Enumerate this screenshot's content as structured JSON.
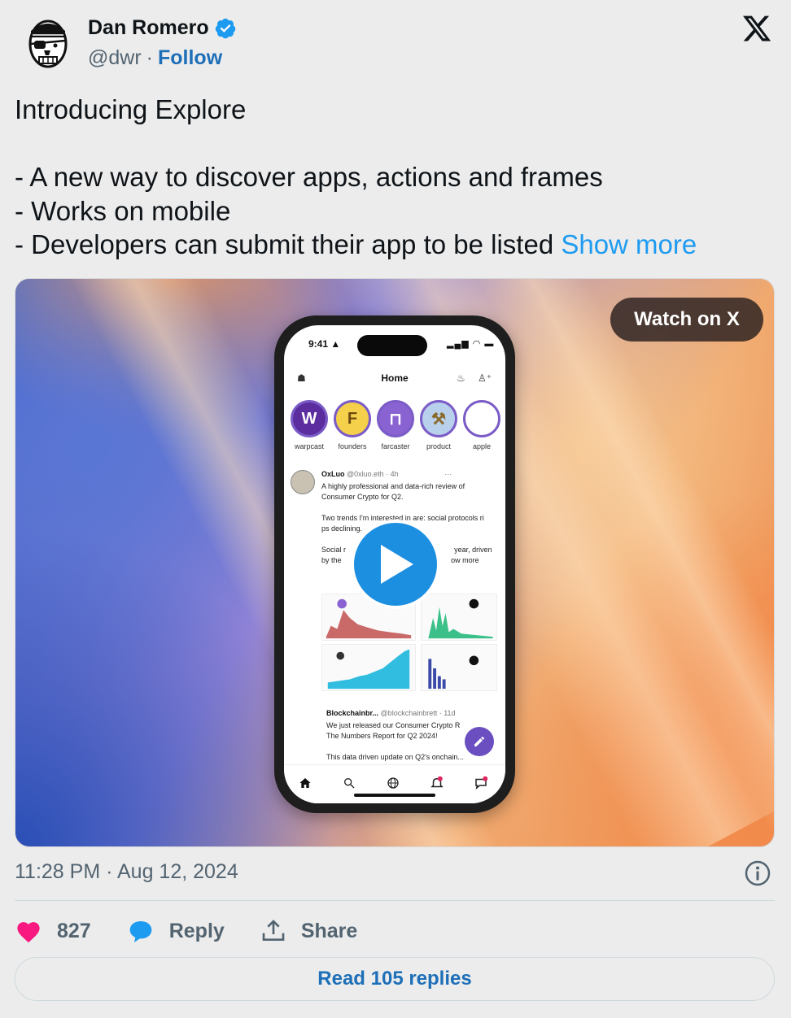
{
  "author": {
    "name": "Dan Romero",
    "handle": "@dwr",
    "separator": "·",
    "follow_label": "Follow",
    "verified": true
  },
  "tweet": {
    "text": "Introducing Explore\n\n- A new way to discover apps, actions and frames\n- Works on mobile\n- Developers can submit their app to be listed ",
    "show_more_label": "Show more"
  },
  "media": {
    "watch_label": "Watch on X",
    "phone": {
      "status_time": "9:41",
      "app_title": "Home",
      "channels": [
        {
          "glyph": "W",
          "label": "warpcast",
          "color": "#5b2d9e",
          "bg": "#5b2d9e",
          "fg": "#ffffff"
        },
        {
          "glyph": "F",
          "label": "founders",
          "color": "#d8a820",
          "bg": "#f5d04a",
          "fg": "#6b4a10"
        },
        {
          "glyph": "⊓",
          "label": "farcaster",
          "color": "#7b5cc7",
          "bg": "#8a63d2",
          "fg": "#ffffff"
        },
        {
          "glyph": "⚒",
          "label": "product",
          "color": "#8fb0d9",
          "bg": "#b8d0ec",
          "fg": "#8a6a2a"
        },
        {
          "glyph": "",
          "label": "apple",
          "color": "#ffffff",
          "bg": "#ffffff",
          "fg": "#e05050"
        }
      ],
      "post1": {
        "name": "OxLuo",
        "meta": "@0xluo.eth · 4h",
        "more": "···",
        "body": "A highly professional and data-rich review of Consumer Crypto for Q2.\n\nTwo trends I'm interested in are: social protocols ri    ps declining.\n\nSocial r         and Lens have seen i          year, driven by the          , Frames/open action          ow more"
      },
      "post2": {
        "name": "Blockchainbr...",
        "meta": "@blockchainbrett · 11d",
        "body": "We just released our Consumer Crypto R\nThe Numbers Report for Q2 2024!\n\nThis data driven update on Q2's onchain..."
      }
    }
  },
  "footer": {
    "timestamp": "11:28 PM · Aug 12, 2024",
    "like_count": "827",
    "reply_label": "Reply",
    "share_label": "Share",
    "read_replies_label": "Read 105 replies"
  },
  "colors": {
    "like": "#f91880",
    "reply": "#1d9bf0",
    "link": "#1d6fb8",
    "verified": "#1d9bf0"
  },
  "icons": [
    "avatar-pirate",
    "verified-badge-icon",
    "x-logo-icon",
    "play-icon",
    "info-icon",
    "heart-icon",
    "reply-bubble-icon",
    "share-icon"
  ]
}
